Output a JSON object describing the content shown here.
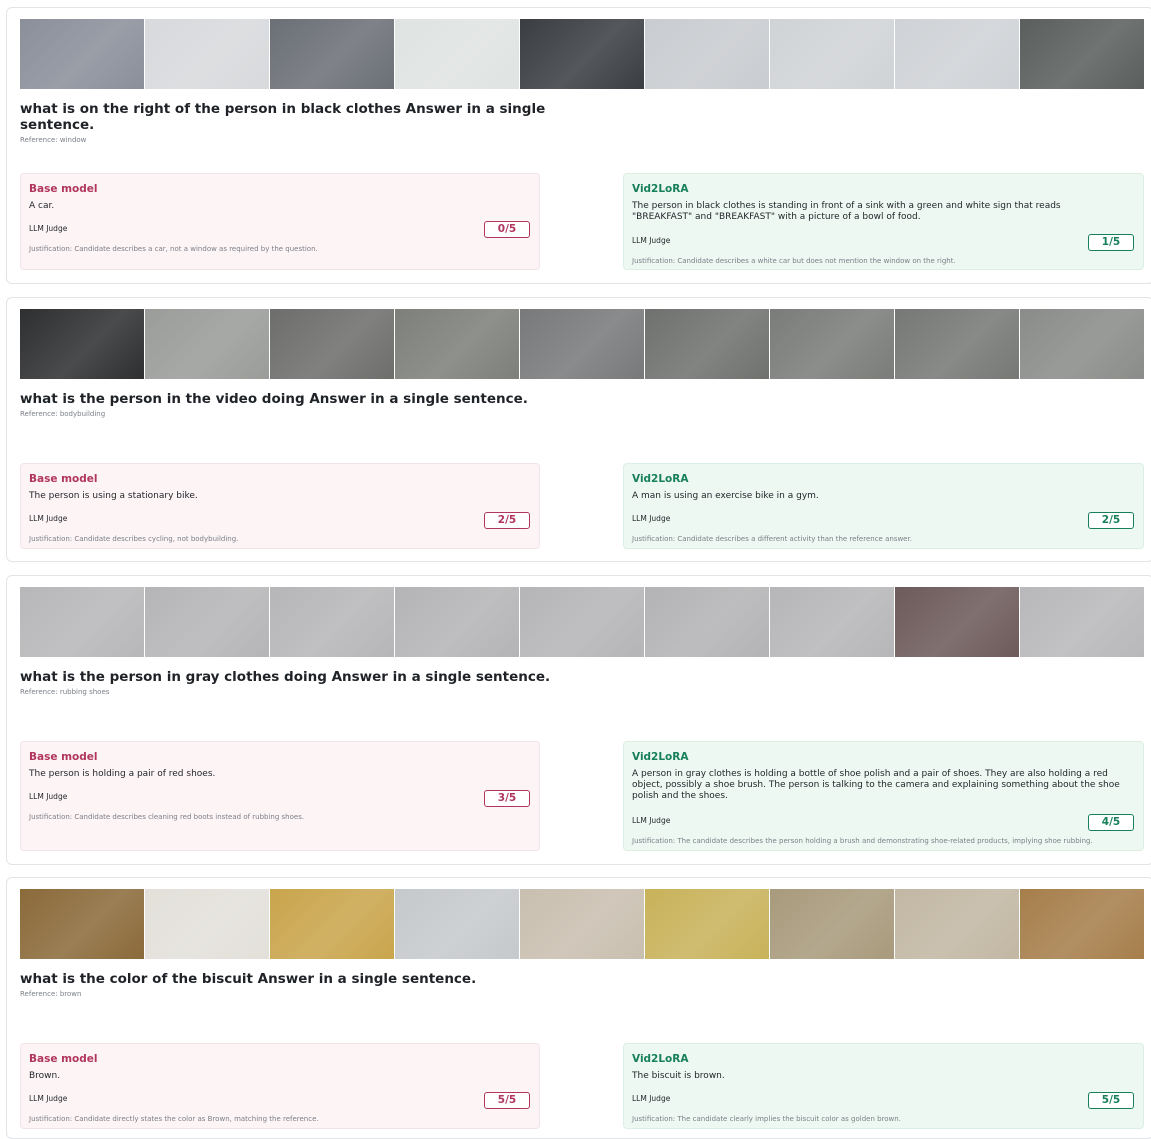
{
  "labels": {
    "base_model": "Base model",
    "vid2lora": "Vid2LoRA",
    "llm_judge": "LLM Judge"
  },
  "examples": [
    {
      "question": "what is on the right of the person in black clothes Answer in a single sentence.",
      "reference": "Reference: window",
      "base": {
        "answer": "A car.",
        "score": "0/5",
        "justification": "Justification: Candidate describes a car, not a window as required by the question."
      },
      "vid2lora": {
        "answer": "The person in black clothes is standing in front of a sink with a green and white sign that reads \"BREAKFAST\" and \"BREAKFAST\" with a picture of a bowl of food.",
        "score": "1/5",
        "justification": "Justification: Candidate describes a white car but does not mention the window on the right."
      }
    },
    {
      "question": "what is the person in the video doing Answer in a single sentence.",
      "reference": "Reference: bodybuilding",
      "base": {
        "answer": "The person is using a stationary bike.",
        "score": "2/5",
        "justification": "Justification: Candidate describes cycling, not bodybuilding."
      },
      "vid2lora": {
        "answer": "A man is using an exercise bike in a gym.",
        "score": "2/5",
        "justification": "Justification: Candidate describes a different activity than the reference answer."
      }
    },
    {
      "question": "what is the person in gray clothes doing Answer in a single sentence.",
      "reference": "Reference: rubbing shoes",
      "base": {
        "answer": "The person is holding a pair of red shoes.",
        "score": "3/5",
        "justification": "Justification: Candidate describes cleaning red boots instead of rubbing shoes."
      },
      "vid2lora": {
        "answer": "A person in gray clothes is holding a bottle of shoe polish and a pair of shoes. They are also holding a red object, possibly a shoe brush. The person is talking to the camera and explaining something about the shoe polish and the shoes.",
        "score": "4/5",
        "justification": "Justification: The candidate describes the person holding a brush and demonstrating shoe-related products, implying shoe rubbing."
      }
    },
    {
      "question": "what is the color of the biscuit Answer in a single sentence.",
      "reference": "Reference: brown",
      "base": {
        "answer": "Brown.",
        "score": "5/5",
        "justification": "Justification: Candidate directly states the color as Brown, matching the reference."
      },
      "vid2lora": {
        "answer": "The biscuit is brown.",
        "score": "5/5",
        "justification": "Justification: The candidate clearly implies the biscuit color as golden brown."
      }
    }
  ],
  "frame_colors": {
    "example0": [
      "#8a8f9a",
      "#d7d9dc",
      "#6b6f76",
      "#dfe3e1",
      "#3a3d42",
      "#c9ccd0",
      "#d0d3d6",
      "#cfd2d6",
      "#5a5e5c"
    ],
    "example1": [
      "#2e2f31",
      "#9a9c99",
      "#6d6e6b",
      "#7d7f7b",
      "#77797a",
      "#6f716e",
      "#7a7c79",
      "#767875",
      "#8a8c89"
    ],
    "example2": [
      "#b7b7b9",
      "#b5b5b7",
      "#b6b6b8",
      "#b4b4b6",
      "#b5b5b7",
      "#b3b3b5",
      "#b6b6b8",
      "#6d5a5a",
      "#b8b8ba"
    ],
    "example3": [
      "#8b6a3a",
      "#e3e0da",
      "#c9a54c",
      "#c6c9cc",
      "#c9bfb0",
      "#c8b25a",
      "#a89a7c",
      "#c2b7a3",
      "#a67e4b"
    ]
  }
}
